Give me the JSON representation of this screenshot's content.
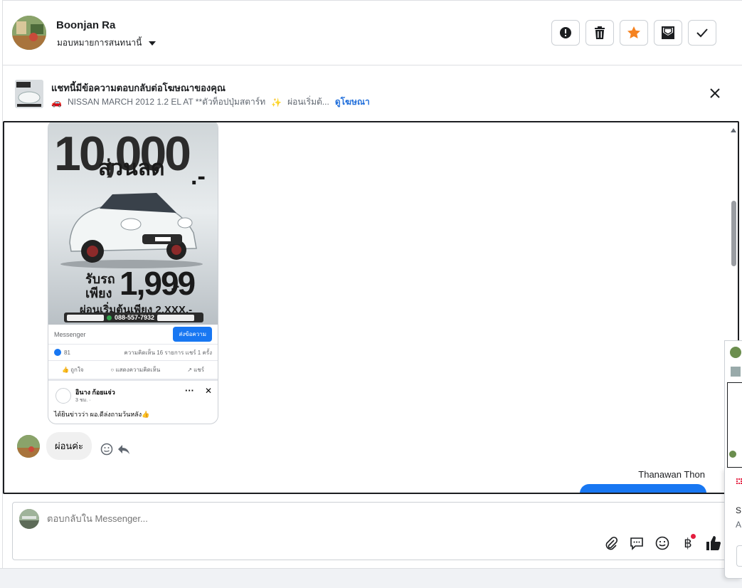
{
  "header": {
    "contact_name": "Boonjan Ra",
    "assign_label": "มอบหมายการสนทนานี้",
    "actions": [
      "report-icon",
      "trash-icon",
      "star-icon",
      "mark-unread-icon",
      "check-icon"
    ],
    "star_color": "#f5821f"
  },
  "ad": {
    "title": "แชทนี้มีข้อความตอบกลับต่อโฆษณาของคุณ",
    "car_emoji": "🚗",
    "description": "NISSAN MARCH 2012 1.2 EL AT **ตัวท็อปปุ่มสตาร์ท",
    "sparkle": "✨",
    "description_tail": "ผ่อนเริ่มต้...",
    "link": "ดูโฆษณา"
  },
  "shared_post": {
    "big_price": "10,000",
    "dash_a": ".-",
    "price_tag": "ส่วนลด",
    "receive_car": "รับรถ",
    "receive_only": "เพียง",
    "receive_amount": "1,999",
    "receive_dash": ".-",
    "installment": "ผ่อนเริ่มต้นเพียง 2,XXX.-",
    "phone": "088-557-7932",
    "messenger_label": "Messenger",
    "send_button": "ส่งข้อความ",
    "like_count": "81",
    "stats": "ความคิดเห็น 16 รายการ  แชร์ 1 ครั้ง",
    "react_like": "ถูกใจ",
    "react_comment": "แสดงความคิดเห็น",
    "react_share": "แชร์",
    "commenter_name": "อินาง ก้อยแจ่ว",
    "comment_time": "3 ชม. · ",
    "comment_text": "ได้ยินข่าวว่า ผอ.ดีล่งถามว้นหลัง👍"
  },
  "messages": {
    "incoming_text": "ผ่อนค่ะ",
    "sender_name": "Thanawan Thon"
  },
  "composer": {
    "placeholder": "ตอบกลับใน Messenger...",
    "baht_symbol": "฿"
  },
  "side": {
    "s_text": "S",
    "a_text": "A"
  },
  "colors": {
    "accent": "#1877f2",
    "link": "#216fdb",
    "notify_dot": "#e41e3f"
  }
}
